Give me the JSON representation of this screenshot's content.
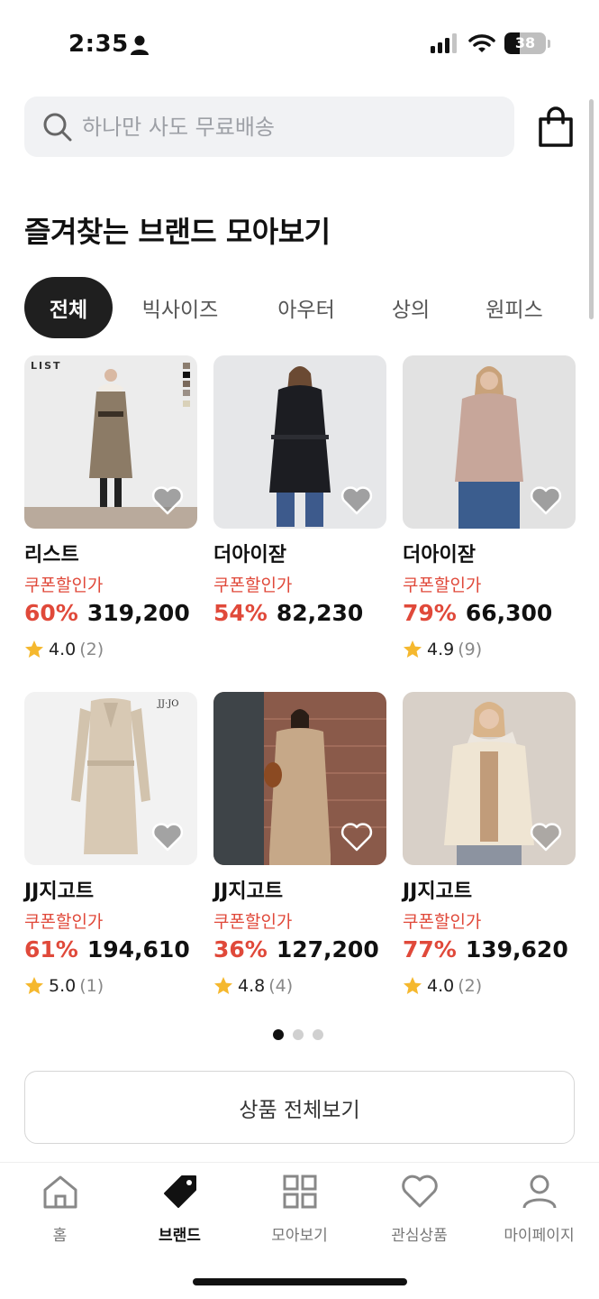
{
  "status_bar": {
    "time": "2:35",
    "battery": "38",
    "battery_level": 0.38
  },
  "search": {
    "placeholder": "하나만 사도 무료배송"
  },
  "section": {
    "title": "즐겨찾는 브랜드 모아보기"
  },
  "tabs": [
    {
      "label": "전체",
      "active": true
    },
    {
      "label": "빅사이즈",
      "active": false
    },
    {
      "label": "아우터",
      "active": false
    },
    {
      "label": "상의",
      "active": false
    },
    {
      "label": "원피스",
      "active": false
    }
  ],
  "products": [
    {
      "brand": "리스트",
      "coupon_label": "쿠폰할인가",
      "discount": "60%",
      "price": "319,200",
      "rating": "4.0",
      "review_count": "(2)",
      "image_logo": "LIST"
    },
    {
      "brand": "더아이잗",
      "coupon_label": "쿠폰할인가",
      "discount": "54%",
      "price": "82,230",
      "rating": "",
      "review_count": ""
    },
    {
      "brand": "더아이잗",
      "coupon_label": "쿠폰할인가",
      "discount": "79%",
      "price": "66,300",
      "rating": "4.9",
      "review_count": "(9)"
    },
    {
      "brand": "JJ지고트",
      "coupon_label": "쿠폰할인가",
      "discount": "61%",
      "price": "194,610",
      "rating": "5.0",
      "review_count": "(1)",
      "image_logo": "JJ·JO"
    },
    {
      "brand": "JJ지고트",
      "coupon_label": "쿠폰할인가",
      "discount": "36%",
      "price": "127,200",
      "rating": "4.8",
      "review_count": "(4)"
    },
    {
      "brand": "JJ지고트",
      "coupon_label": "쿠폰할인가",
      "discount": "77%",
      "price": "139,620",
      "rating": "4.0",
      "review_count": "(2)"
    }
  ],
  "pagination": {
    "current": 1,
    "total": 3
  },
  "view_all_label": "상품 전체보기",
  "nav": [
    {
      "label": "홈",
      "icon": "home-icon",
      "active": false
    },
    {
      "label": "브랜드",
      "icon": "tag-icon",
      "active": true
    },
    {
      "label": "모아보기",
      "icon": "grid-icon",
      "active": false
    },
    {
      "label": "관심상품",
      "icon": "heart-icon",
      "active": false
    },
    {
      "label": "마이페이지",
      "icon": "user-icon",
      "active": false
    }
  ],
  "colors": {
    "accent_red": "#e0493a",
    "star": "#f5b82e",
    "active_tab_bg": "#1f1f1f",
    "search_bg": "#f1f2f4"
  }
}
